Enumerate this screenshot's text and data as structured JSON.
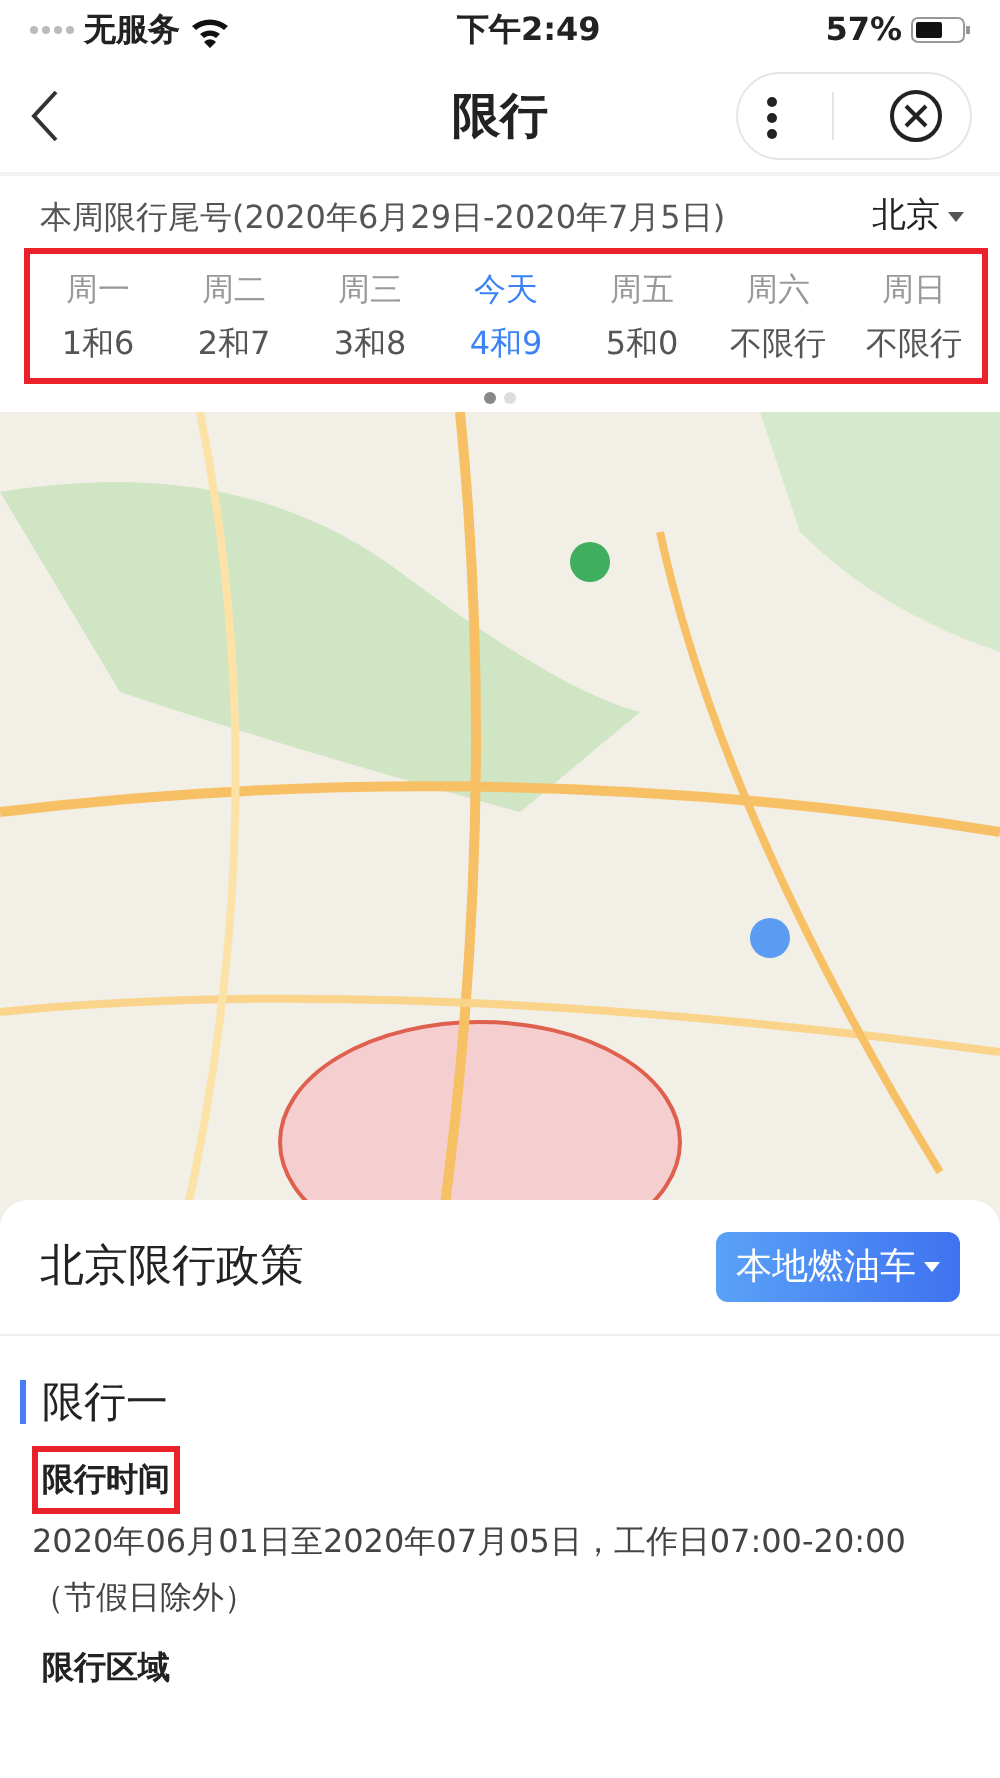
{
  "status_bar": {
    "carrier": "无服务",
    "time": "下午2:49",
    "battery": "57%"
  },
  "nav": {
    "title": "限行"
  },
  "week_header": {
    "title": "本周限行尾号(2020年6月29日-2020年7月5日)",
    "city": "北京"
  },
  "days": [
    {
      "day": "周一",
      "numbers": "1和6",
      "selected": false
    },
    {
      "day": "周二",
      "numbers": "2和7",
      "selected": false
    },
    {
      "day": "周三",
      "numbers": "3和8",
      "selected": false
    },
    {
      "day": "今天",
      "numbers": "4和9",
      "selected": true
    },
    {
      "day": "周五",
      "numbers": "5和0",
      "selected": false
    },
    {
      "day": "周六",
      "numbers": "不限行",
      "selected": false
    },
    {
      "day": "周日",
      "numbers": "不限行",
      "selected": false
    }
  ],
  "pager": [
    {
      "selected": true
    },
    {
      "selected": false
    }
  ],
  "policy": {
    "title": "北京限行政策",
    "filter": "本地燃油车",
    "section": "限行一",
    "items": [
      {
        "label": "限行时间",
        "text": "2020年06月01日至2020年07月05日，工作日07:00-20:00（节假日除外）",
        "highlighted": true
      },
      {
        "label": "限行区域",
        "highlighted": false
      }
    ]
  }
}
